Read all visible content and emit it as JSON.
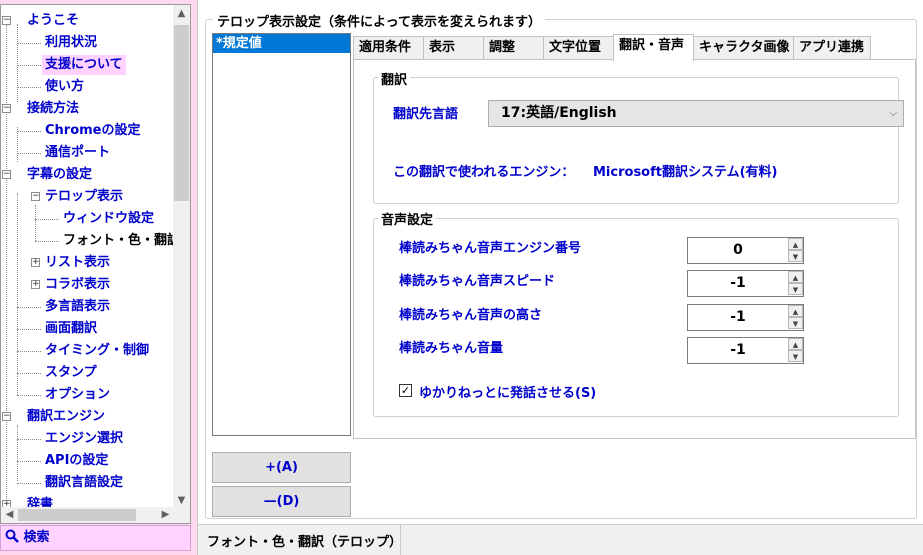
{
  "tree": {
    "items": [
      {
        "label": "ようこそ"
      },
      {
        "label": "利用状況"
      },
      {
        "label": "支援について"
      },
      {
        "label": "使い方"
      },
      {
        "label": "接続方法"
      },
      {
        "label": "Chromeの設定"
      },
      {
        "label": "通信ポート"
      },
      {
        "label": "字幕の設定"
      },
      {
        "label": "テロップ表示"
      },
      {
        "label": "ウィンドウ設定"
      },
      {
        "label": "フォント・色・翻訳"
      },
      {
        "label": "リスト表示"
      },
      {
        "label": "コラボ表示"
      },
      {
        "label": "多言語表示"
      },
      {
        "label": "画面翻訳"
      },
      {
        "label": "タイミング・制御"
      },
      {
        "label": "スタンプ"
      },
      {
        "label": "オプション"
      },
      {
        "label": "翻訳エンジン"
      },
      {
        "label": "エンジン選択"
      },
      {
        "label": "APIの設定"
      },
      {
        "label": "翻訳言語設定"
      },
      {
        "label": "辞書"
      }
    ]
  },
  "search": {
    "label": "検索"
  },
  "panel": {
    "title": "テロップ表示設定（条件によって表示を変えられます）",
    "rules": [
      "*規定値"
    ],
    "add_button": "+(A)",
    "remove_button": "—(D)"
  },
  "tabs": [
    "適用条件",
    "表示",
    "調整",
    "文字位置",
    "翻訳・音声",
    "キャラクタ画像",
    "アプリ連携"
  ],
  "translation": {
    "group_title": "翻訳",
    "target_label": "翻訳先言語",
    "target_value": "17:英語/English",
    "engine_label": "この翻訳で使われるエンジン：",
    "engine_value": "Microsoft翻訳システム(有料)"
  },
  "voice": {
    "group_title": "音声設定",
    "rows": [
      {
        "label": "棒読みちゃん音声エンジン番号",
        "value": "0"
      },
      {
        "label": "棒読みちゃん音声スピード",
        "value": "-1"
      },
      {
        "label": "棒読みちゃん音声の高さ",
        "value": "-1"
      },
      {
        "label": "棒読みちゃん音量",
        "value": "-1"
      }
    ],
    "checkbox_label": "ゆかりねっとに発話させる(S)",
    "checkbox_checked": true
  },
  "status": {
    "text": "フォント・色・翻訳（テロップ）"
  }
}
